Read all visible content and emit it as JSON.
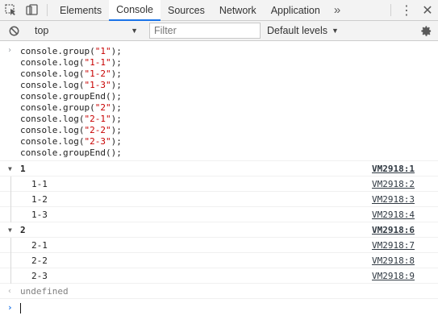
{
  "tabs": {
    "items": [
      "Elements",
      "Console",
      "Sources",
      "Network",
      "Application"
    ],
    "active": "Console",
    "more": "»",
    "menu": "⋮",
    "close": "✕"
  },
  "toolbar": {
    "context": "top",
    "filter_placeholder": "Filter",
    "levels": "Default levels"
  },
  "console": {
    "input_prompt": "›",
    "code": [
      [
        "console.group(",
        "\"1\"",
        ");"
      ],
      [
        "console.log(",
        "\"1-1\"",
        ");"
      ],
      [
        "console.log(",
        "\"1-2\"",
        ");"
      ],
      [
        "console.log(",
        "\"1-3\"",
        ");"
      ],
      [
        "console.groupEnd();",
        "",
        ""
      ],
      [
        "console.group(",
        "\"2\"",
        ");"
      ],
      [
        "console.log(",
        "\"2-1\"",
        ");"
      ],
      [
        "console.log(",
        "\"2-2\"",
        ");"
      ],
      [
        "console.log(",
        "\"2-3\"",
        ");"
      ],
      [
        "console.groupEnd();",
        "",
        ""
      ]
    ],
    "groups": [
      {
        "label": "1",
        "source": "VM2918:1",
        "children": [
          {
            "label": "1-1",
            "source": "VM2918:2"
          },
          {
            "label": "1-2",
            "source": "VM2918:3"
          },
          {
            "label": "1-3",
            "source": "VM2918:4"
          }
        ]
      },
      {
        "label": "2",
        "source": "VM2918:6",
        "children": [
          {
            "label": "2-1",
            "source": "VM2918:7"
          },
          {
            "label": "2-2",
            "source": "VM2918:8"
          },
          {
            "label": "2-3",
            "source": "VM2918:9"
          }
        ]
      }
    ],
    "result_prompt": "‹",
    "result": "undefined",
    "caret_prompt": "›"
  }
}
